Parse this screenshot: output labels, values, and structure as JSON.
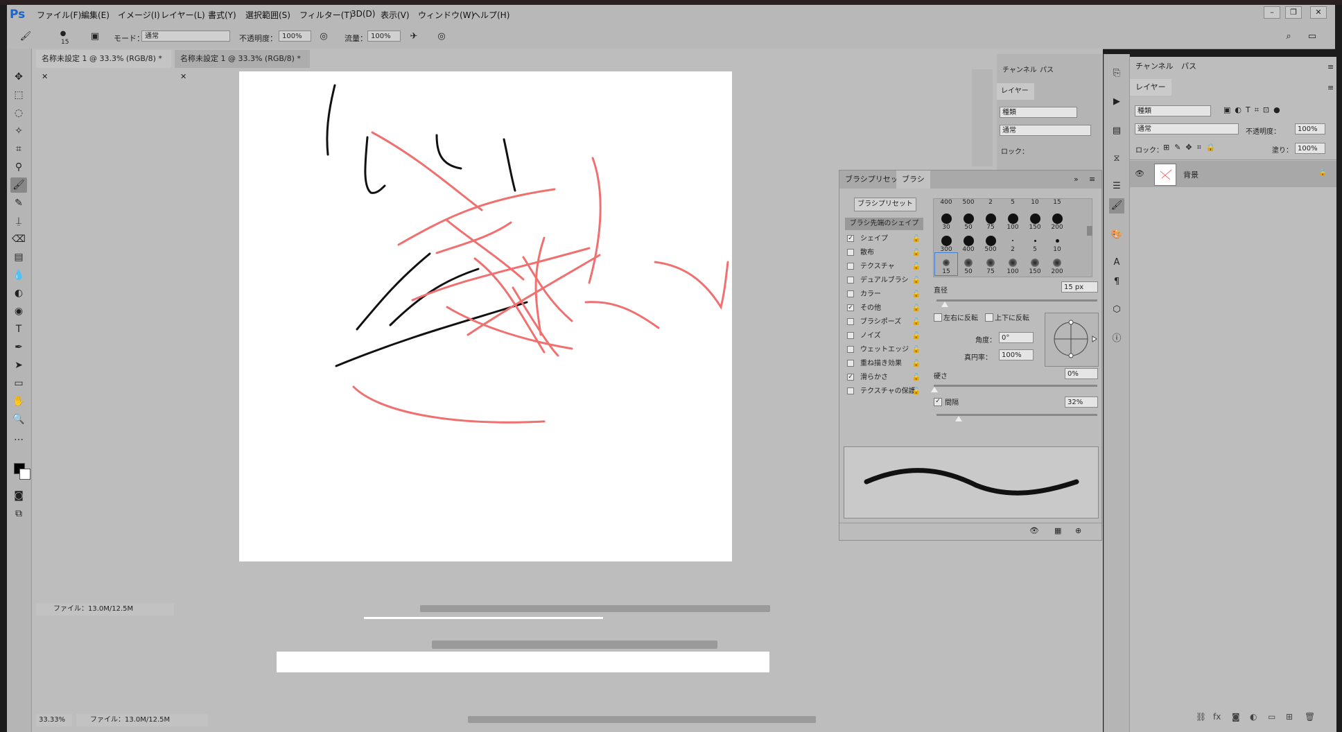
{
  "app": {
    "logo": "Ps"
  },
  "menu": [
    "ファイル(F)",
    "編集(E)",
    "イメージ(I)",
    "レイヤー(L)",
    "書式(Y)",
    "選択範囲(S)",
    "フィルター(T)",
    "3D(D)",
    "表示(V)",
    "ウィンドウ(W)",
    "ヘルプ(H)"
  ],
  "window_controls": [
    "–",
    "❐",
    "✕"
  ],
  "options": {
    "brush_size": "15",
    "mode_label": "モード：",
    "mode_value": "通常",
    "opacity_label": "不透明度：",
    "opacity_value": "100%",
    "flow_label": "流量：",
    "flow_value": "100%"
  },
  "tabs": [
    "名称未設定 1 @ 33.3% (RGB/8) *",
    "名称未設定 1 @ 33.3% (RGB/8) *"
  ],
  "status": {
    "file_info": "ファイル：13.0M/12.5M",
    "zoom": "33.33%",
    "file_info2": "ファイル：13.0M/12.5M"
  },
  "brush_panel": {
    "tabs": [
      "ブラシプリセット",
      "ブラシ"
    ],
    "preset_button": "ブラシプリセット",
    "header": "ブラシ先端のシェイプ",
    "options": [
      {
        "label": "シェイプ",
        "checked": true
      },
      {
        "label": "散布",
        "checked": false
      },
      {
        "label": "テクスチャ",
        "checked": false
      },
      {
        "label": "デュアルブラシ",
        "checked": false
      },
      {
        "label": "カラー",
        "checked": false
      },
      {
        "label": "その他",
        "checked": true
      },
      {
        "label": "ブラシポーズ",
        "checked": false
      },
      {
        "label": "ノイズ",
        "checked": false
      },
      {
        "label": "ウェットエッジ",
        "checked": false
      },
      {
        "label": "重ね描き効果",
        "checked": false
      },
      {
        "label": "滑らかさ",
        "checked": true
      },
      {
        "label": "テクスチャの保護",
        "checked": false
      }
    ],
    "tip_header": [
      "400",
      "500",
      "2",
      "5",
      "10",
      "15"
    ],
    "tips_row1": [
      "30",
      "50",
      "75",
      "100",
      "150",
      "200"
    ],
    "tips_row2": [
      "300",
      "400",
      "500",
      "2",
      "5",
      "10"
    ],
    "tips_row3": [
      "15",
      "50",
      "75",
      "100",
      "150",
      "200"
    ],
    "diameter_label": "直径",
    "diameter_value": "15 px",
    "flip_x": "左右に反転",
    "flip_y": "上下に反転",
    "angle_label": "角度：",
    "angle_value": "0°",
    "roundness_label": "真円率：",
    "roundness_value": "100%",
    "hardness_label": "硬さ",
    "hardness_value": "0%",
    "spacing_label": "間隔",
    "spacing_value": "32%"
  },
  "mid_panel": {
    "tabs": [
      "チャンネル",
      "パス"
    ],
    "layer_tab": "レイヤー",
    "search": "種類",
    "blend": "通常",
    "lock": "ロック："
  },
  "layers_panel": {
    "tabs": [
      "チャンネル",
      "パス"
    ],
    "layer_tab": "レイヤー",
    "kind": "種類",
    "blend": "通常",
    "opacity_label": "不透明度：",
    "opacity_value": "100%",
    "lock_label": "ロック：",
    "fill_label": "塗り：",
    "fill_value": "100%",
    "layer_name": "背景"
  }
}
